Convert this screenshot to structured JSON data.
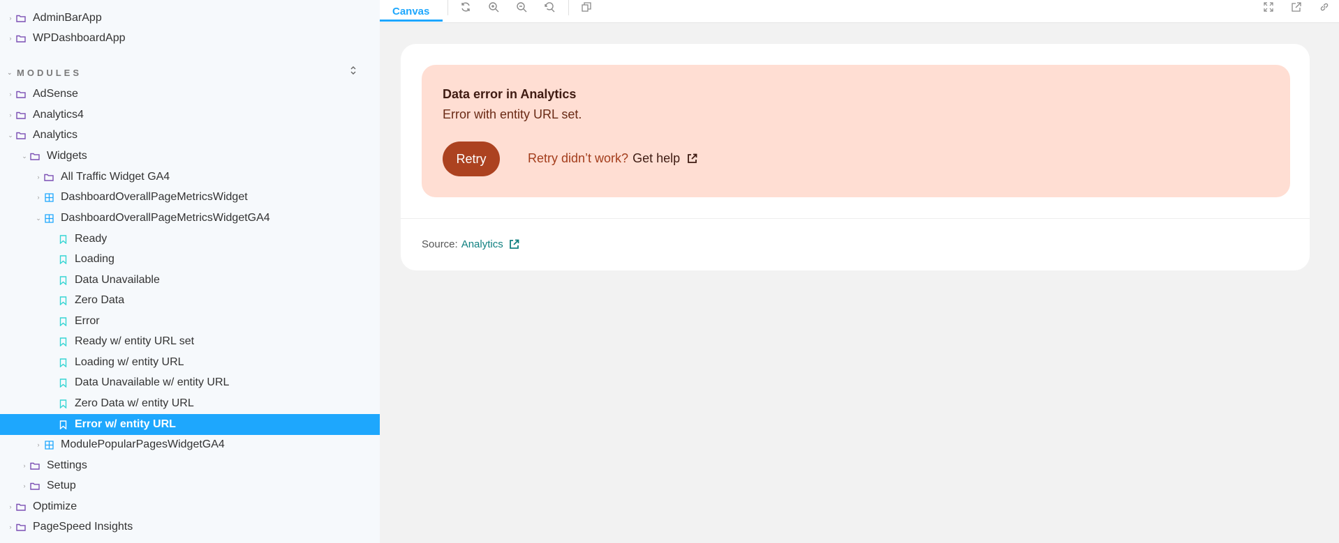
{
  "sidebar": {
    "top_items": [
      {
        "label": "AdminBarApp"
      },
      {
        "label": "WPDashboardApp"
      }
    ],
    "section_title": "MODULES",
    "modules": [
      {
        "label": "AdSense"
      },
      {
        "label": "Analytics4"
      },
      {
        "label": "Analytics"
      },
      {
        "label": "Widgets"
      },
      {
        "label": "All Traffic Widget GA4"
      },
      {
        "label": "DashboardOverallPageMetricsWidget"
      },
      {
        "label": "DashboardOverallPageMetricsWidgetGA4"
      },
      {
        "label": "Ready"
      },
      {
        "label": "Loading"
      },
      {
        "label": "Data Unavailable"
      },
      {
        "label": "Zero Data"
      },
      {
        "label": "Error"
      },
      {
        "label": "Ready w/ entity URL set"
      },
      {
        "label": "Loading w/ entity URL"
      },
      {
        "label": "Data Unavailable w/ entity URL"
      },
      {
        "label": "Zero Data w/ entity URL"
      },
      {
        "label": "Error w/ entity URL"
      },
      {
        "label": "ModulePopularPagesWidgetGA4"
      },
      {
        "label": "Settings"
      },
      {
        "label": "Setup"
      },
      {
        "label": "Optimize"
      },
      {
        "label": "PageSpeed Insights"
      }
    ]
  },
  "toolbar": {
    "tab_label": "Canvas",
    "icons": [
      "refresh-icon",
      "zoom-in-icon",
      "zoom-out-icon",
      "reset-zoom-icon",
      "grid-icon",
      "fullscreen-icon",
      "open-new-tab-icon",
      "copy-link-icon"
    ]
  },
  "error_card": {
    "title": "Data error in Analytics",
    "description": "Error with entity URL set.",
    "retry_label": "Retry",
    "help_prefix": "Retry didn’t work?",
    "help_link": "Get help",
    "source_prefix": "Source:",
    "source_link": "Analytics"
  },
  "colors": {
    "accent": "#1ea7fd",
    "error_bg": "#ffded3",
    "retry_button": "#ac4220",
    "source_link": "#108080"
  }
}
